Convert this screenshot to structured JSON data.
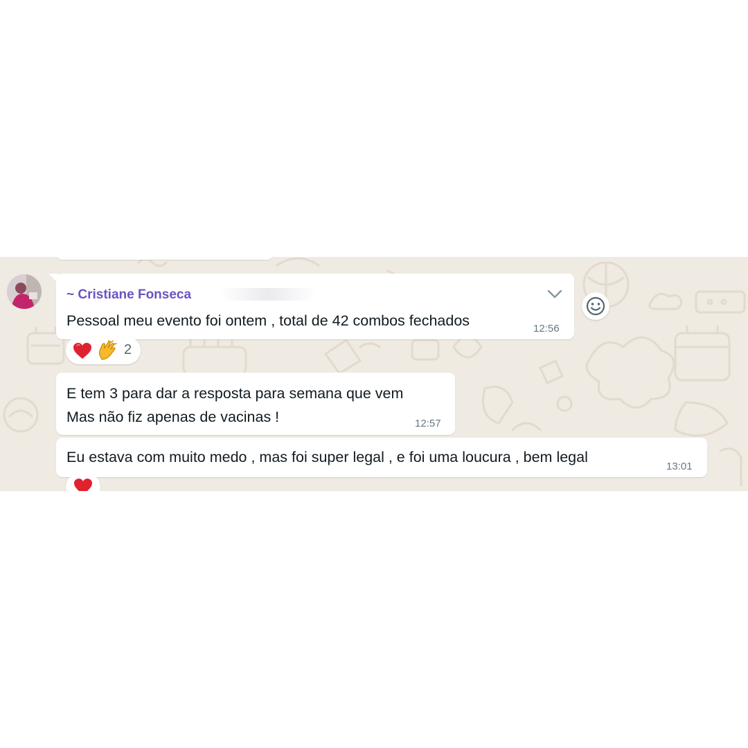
{
  "chat": {
    "colors": {
      "wallpaper": "#efeae2",
      "bubble": "#ffffff",
      "sender": "#6a52c2",
      "text": "#111b21",
      "time": "#667781"
    },
    "messages": [
      {
        "sender": "~ Cristiane Fonseca",
        "text": "Pessoal meu evento foi ontem , total de 42 combos fechados",
        "time": "12:56",
        "reactions": {
          "icons": [
            "heart-icon",
            "clapping-hands-icon"
          ],
          "count": "2"
        }
      },
      {
        "lines": [
          "E tem 3 para dar a resposta para semana que vem",
          "Mas não fiz apenas de vacinas !"
        ],
        "time": "12:57"
      },
      {
        "text": "Eu estava com muito medo , mas foi super legal , e foi uma loucura , bem legal",
        "time": "13:01",
        "reactions": {
          "icons": [
            "heart-icon"
          ]
        }
      }
    ],
    "icons": {
      "menu": "chevron-down-icon",
      "react": "smiley-icon",
      "avatar": "avatar-photo"
    }
  }
}
